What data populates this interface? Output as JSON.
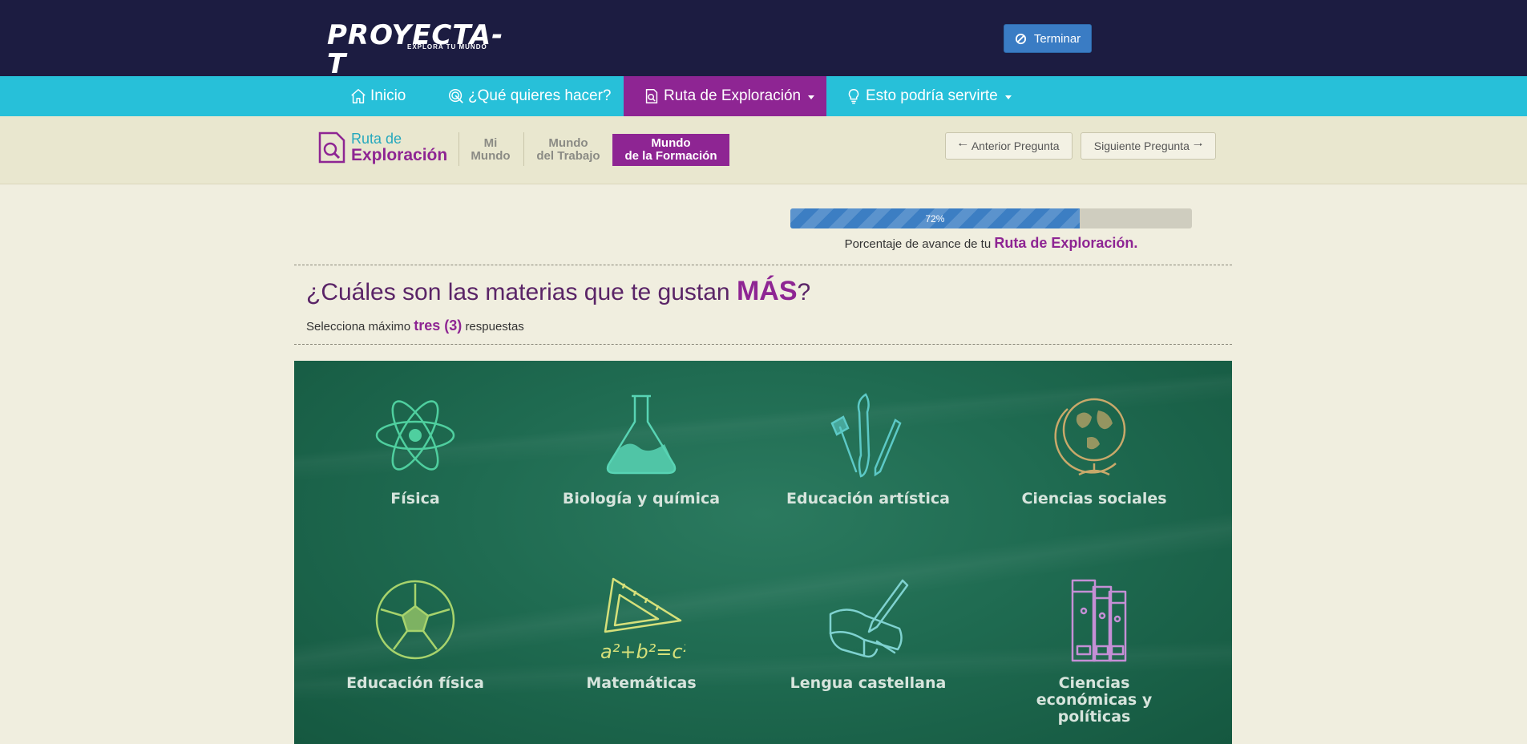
{
  "header": {
    "logo_text": "PROYECTA-T",
    "logo_tagline": "EXPLORA TU MUNDO",
    "finish_button": "Terminar",
    "finish_icon": "ban-icon"
  },
  "nav": {
    "items": [
      {
        "label": "Inicio",
        "icon": "home-icon"
      },
      {
        "label": "¿Qué quieres hacer?",
        "icon": "target-icon"
      },
      {
        "label": "Ruta de Exploración",
        "icon": "search-document-icon",
        "active": true
      },
      {
        "label": "Esto podría servirte",
        "icon": "lightbulb-icon"
      }
    ]
  },
  "route": {
    "title_line1": "Ruta de",
    "title_line2": "Exploración",
    "steps": [
      {
        "line1": "Mi",
        "line2": "Mundo"
      },
      {
        "line1": "Mundo",
        "line2": "del Trabajo"
      },
      {
        "line1": "Mundo",
        "line2": "de la Formación",
        "active": true
      }
    ],
    "prev_button": "Anterior Pregunta",
    "next_button": "Siguiente Pregunta"
  },
  "progress": {
    "value": 72,
    "label": "72%",
    "caption_prefix": "Porcentaje de avance de tu",
    "caption_bold": "Ruta de Exploración."
  },
  "question": {
    "text": "¿Cuáles son las materias que te gustan",
    "emphasis": "MÁS",
    "suffix": "?",
    "instruction_prefix": "Selecciona máximo",
    "instruction_bold": "tres (3)",
    "instruction_suffix": "respuestas"
  },
  "subjects": [
    {
      "label": "Física",
      "icon": "atom-icon",
      "color": "#4fcf9f"
    },
    {
      "label": "Biología y química",
      "icon": "flask-icon",
      "color": "#58d4b4"
    },
    {
      "label": "Educación artística",
      "icon": "art-brushes-icon",
      "color": "#5cc9c6"
    },
    {
      "label": "Ciencias sociales",
      "icon": "globe-icon",
      "color": "#c9a96a"
    },
    {
      "label": "Educación física",
      "icon": "soccer-ball-icon",
      "color": "#a7d36c"
    },
    {
      "label": "Matemáticas",
      "icon": "ruler-formula-icon",
      "color": "#d6e07a"
    },
    {
      "label": "Lengua castellana",
      "icon": "book-pen-icon",
      "color": "#7fd2d0"
    },
    {
      "label": "Ciencias económicas y políticas",
      "icon": "binders-icon",
      "color": "#c58fd6"
    }
  ]
}
